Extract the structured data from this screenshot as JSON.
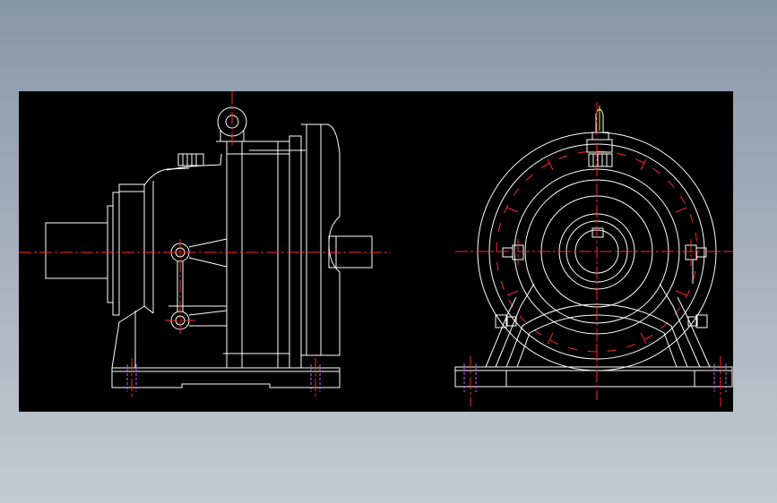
{
  "drawing": {
    "background": "#000000",
    "line_color": "#ffffff",
    "centerline_color": "#ff2a2a",
    "hidden_line_color": "#d05cff",
    "accent_color": "#ffee00"
  },
  "views": [
    {
      "id": "side-view",
      "kind": "side elevation"
    },
    {
      "id": "front-view",
      "kind": "end elevation"
    }
  ]
}
